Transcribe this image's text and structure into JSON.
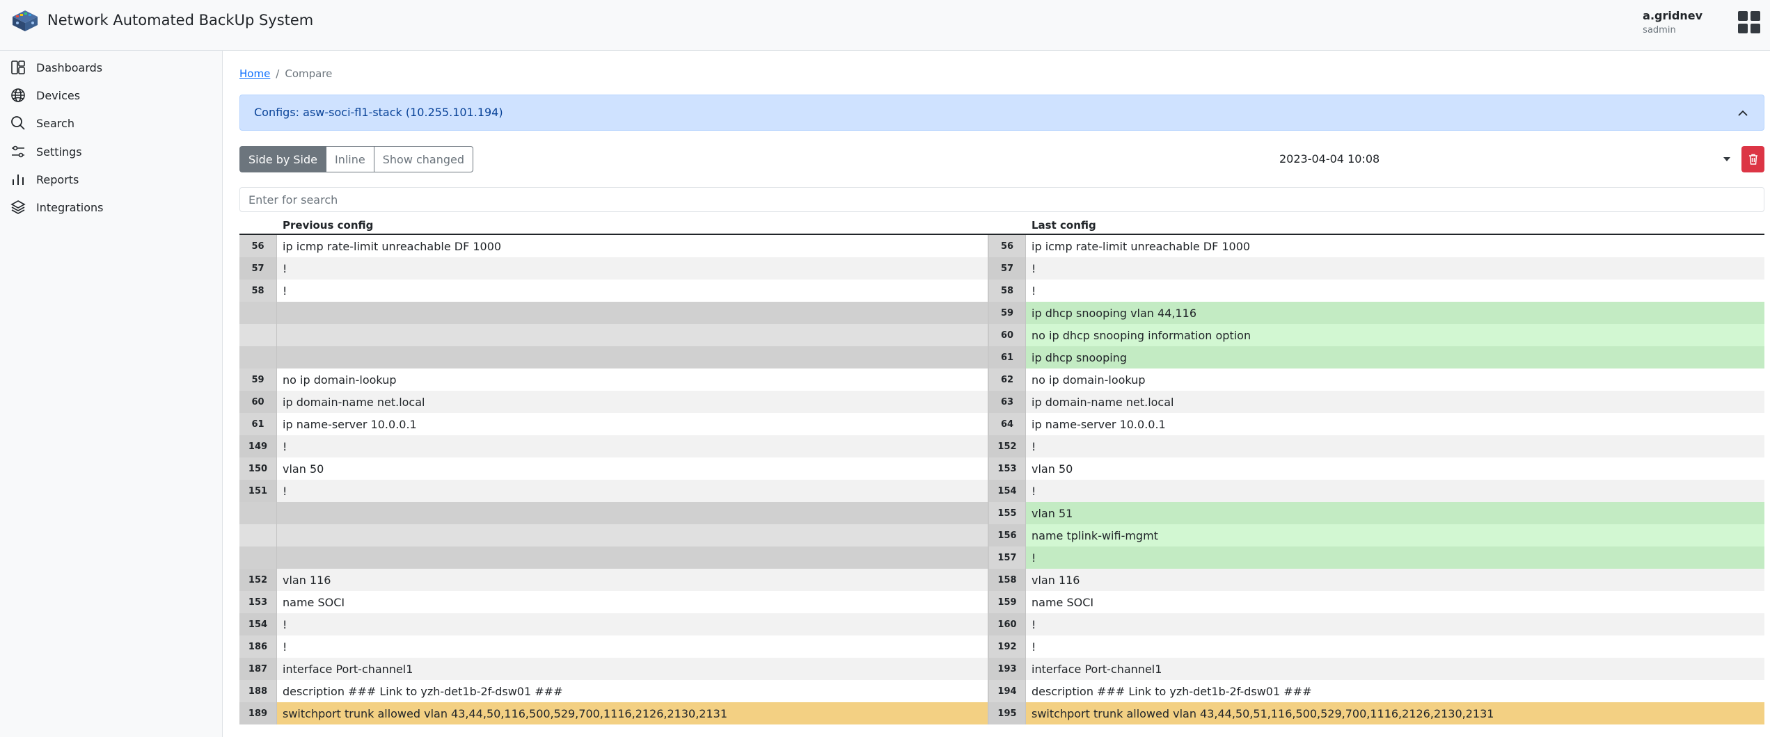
{
  "app": {
    "title": "Network Automated BackUp System"
  },
  "user": {
    "name": "a.gridnev",
    "role": "sadmin"
  },
  "sidebar": {
    "items": [
      {
        "label": "Dashboards",
        "icon": "dashboard-icon"
      },
      {
        "label": "Devices",
        "icon": "globe-icon"
      },
      {
        "label": "Search",
        "icon": "search-icon"
      },
      {
        "label": "Settings",
        "icon": "sliders-icon"
      },
      {
        "label": "Reports",
        "icon": "bar-chart-icon"
      },
      {
        "label": "Integrations",
        "icon": "layers-icon"
      }
    ]
  },
  "breadcrumb": {
    "home": "Home",
    "separator": "/",
    "current": "Compare"
  },
  "config_bar": {
    "title": "Configs: asw-soci-fl1-stack (10.255.101.194)"
  },
  "view_modes": {
    "side_by_side": "Side by Side",
    "inline": "Inline",
    "show_changed": "Show changed",
    "active": "side_by_side"
  },
  "date_select": {
    "value": "2023-04-04 10:08"
  },
  "search": {
    "placeholder": "Enter for search"
  },
  "diff": {
    "left_header": "Previous config",
    "right_header": "Last config",
    "rows": [
      {
        "ln_l": "56",
        "text_l": "ip icmp rate-limit unreachable DF 1000",
        "ln_r": "56",
        "text_r": "ip icmp rate-limit unreachable DF 1000",
        "type": "same"
      },
      {
        "ln_l": "57",
        "text_l": "!",
        "ln_r": "57",
        "text_r": "!",
        "type": "same"
      },
      {
        "ln_l": "58",
        "text_l": "!",
        "ln_r": "58",
        "text_r": "!",
        "type": "same"
      },
      {
        "ln_l": "",
        "text_l": "",
        "ln_r": "59",
        "text_r": "ip dhcp snooping vlan 44,116",
        "type": "added"
      },
      {
        "ln_l": "",
        "text_l": "",
        "ln_r": "60",
        "text_r": "no ip dhcp snooping information option",
        "type": "added"
      },
      {
        "ln_l": "",
        "text_l": "",
        "ln_r": "61",
        "text_r": "ip dhcp snooping",
        "type": "added"
      },
      {
        "ln_l": "59",
        "text_l": "no ip domain-lookup",
        "ln_r": "62",
        "text_r": "no ip domain-lookup",
        "type": "same"
      },
      {
        "ln_l": "60",
        "text_l": "ip domain-name net.local",
        "ln_r": "63",
        "text_r": "ip domain-name net.local",
        "type": "same"
      },
      {
        "ln_l": "61",
        "text_l": "ip name-server 10.0.0.1",
        "ln_r": "64",
        "text_r": "ip name-server 10.0.0.1",
        "type": "same"
      },
      {
        "ln_l": "149",
        "text_l": "!",
        "ln_r": "152",
        "text_r": "!",
        "type": "same"
      },
      {
        "ln_l": "150",
        "text_l": "vlan 50",
        "ln_r": "153",
        "text_r": "vlan 50",
        "type": "same"
      },
      {
        "ln_l": "151",
        "text_l": "!",
        "ln_r": "154",
        "text_r": "!",
        "type": "same"
      },
      {
        "ln_l": "",
        "text_l": "",
        "ln_r": "155",
        "text_r": "vlan 51",
        "type": "added"
      },
      {
        "ln_l": "",
        "text_l": "",
        "ln_r": "156",
        "text_r": "name tplink-wifi-mgmt",
        "type": "added"
      },
      {
        "ln_l": "",
        "text_l": "",
        "ln_r": "157",
        "text_r": "!",
        "type": "added"
      },
      {
        "ln_l": "152",
        "text_l": "vlan 116",
        "ln_r": "158",
        "text_r": "vlan 116",
        "type": "same"
      },
      {
        "ln_l": "153",
        "text_l": "name SOCI",
        "ln_r": "159",
        "text_r": "name SOCI",
        "type": "same"
      },
      {
        "ln_l": "154",
        "text_l": "!",
        "ln_r": "160",
        "text_r": "!",
        "type": "same"
      },
      {
        "ln_l": "186",
        "text_l": "!",
        "ln_r": "192",
        "text_r": "!",
        "type": "same"
      },
      {
        "ln_l": "187",
        "text_l": "interface Port-channel1",
        "ln_r": "193",
        "text_r": "interface Port-channel1",
        "type": "same"
      },
      {
        "ln_l": "188",
        "text_l": "description ### Link to yzh-det1b-2f-dsw01 ###",
        "ln_r": "194",
        "text_r": "description ### Link to yzh-det1b-2f-dsw01 ###",
        "type": "same"
      },
      {
        "ln_l": "189",
        "text_l": "switchport trunk allowed vlan 43,44,50,116,500,529,700,1116,2126,2130,2131",
        "ln_r": "195",
        "text_r": "switchport trunk allowed vlan 43,44,50,51,116,500,529,700,1116,2126,2130,2131",
        "type": "changed"
      }
    ]
  },
  "colors": {
    "added": "#c3ebc3",
    "changed": "#f3d083",
    "delete_button": "#dc3545",
    "config_bar": "#cfe2ff"
  }
}
